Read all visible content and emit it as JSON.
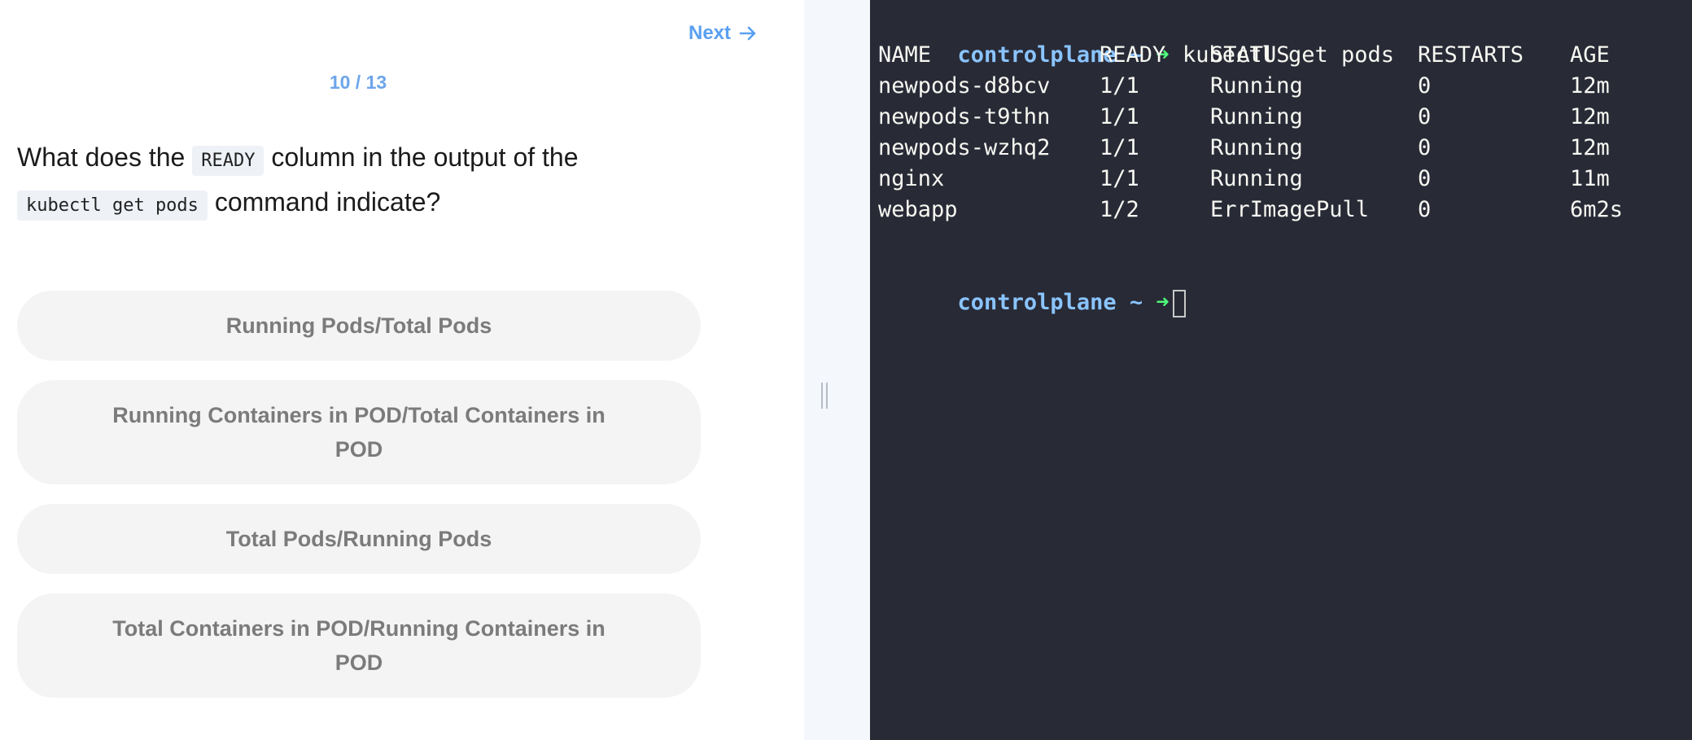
{
  "quiz": {
    "next_label": "Next",
    "progress": "10 / 13",
    "question": {
      "part1": "What does the ",
      "code1": "READY",
      "part2": " column in the output of the ",
      "code2": "kubectl get pods",
      "part3": " command indicate?"
    },
    "options": [
      "Running Pods/Total Pods",
      "Running Containers in POD/Total Containers in POD",
      "Total Pods/Running Pods",
      "Total Containers in POD/Running Containers in POD"
    ]
  },
  "terminal": {
    "prompt_host": "controlplane",
    "prompt_tilde": "~",
    "prompt_arrow": "➜",
    "command": "kubectl get pods",
    "columns": [
      "NAME",
      "READY",
      "STATUS",
      "RESTARTS",
      "AGE"
    ],
    "rows": [
      [
        "newpods-d8bcv",
        "1/1",
        "Running",
        "0",
        "12m"
      ],
      [
        "newpods-t9thn",
        "1/1",
        "Running",
        "0",
        "12m"
      ],
      [
        "newpods-wzhq2",
        "1/1",
        "Running",
        "0",
        "12m"
      ],
      [
        "nginx",
        "1/1",
        "Running",
        "0",
        "11m"
      ],
      [
        "webapp",
        "1/2",
        "ErrImagePull",
        "0",
        "6m2s"
      ]
    ]
  },
  "colors": {
    "accent": "#5aa0f2",
    "terminal_bg": "#282a36",
    "prompt_host": "#8ac4ff",
    "prompt_arrow": "#50fa7b"
  }
}
